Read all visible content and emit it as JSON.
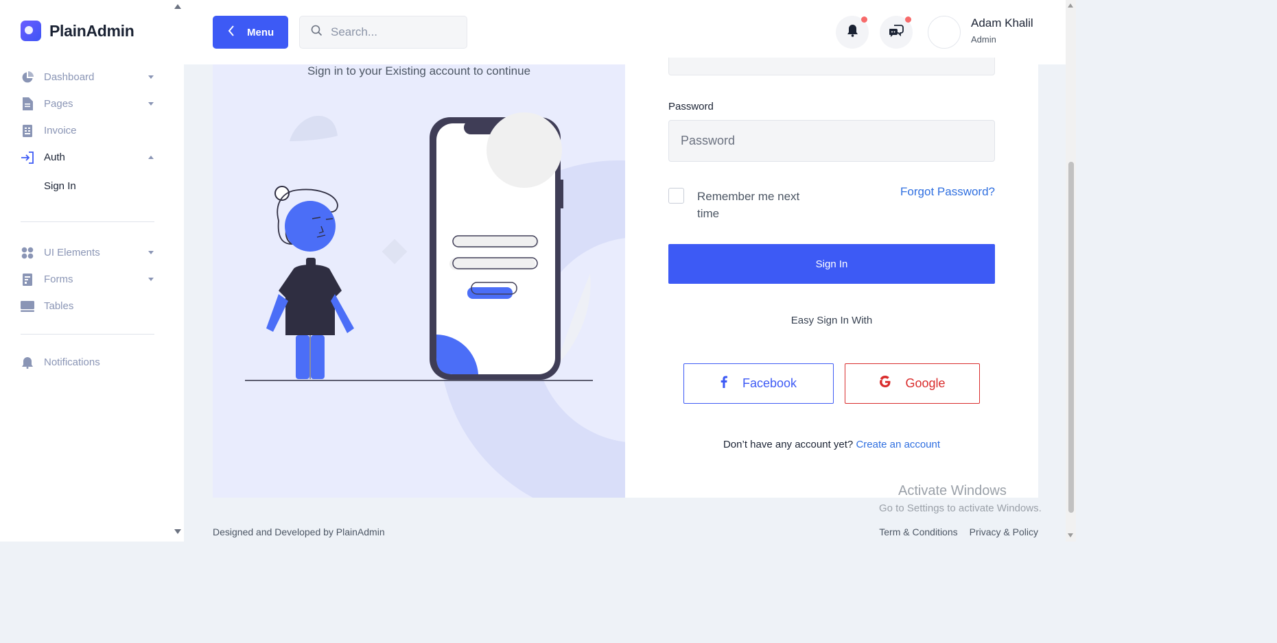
{
  "brand": {
    "name": "PlainAdmin"
  },
  "sidebar": {
    "items": [
      {
        "label": "Dashboard",
        "icon": "pie-chart-icon",
        "has_caret": true
      },
      {
        "label": "Pages",
        "icon": "document-icon",
        "has_caret": true
      },
      {
        "label": "Invoice",
        "icon": "receipt-icon",
        "has_caret": false
      },
      {
        "label": "Auth",
        "icon": "sign-in-icon",
        "has_caret": true,
        "expanded": true,
        "active": true
      }
    ],
    "sub_items": [
      {
        "label": "Sign In"
      }
    ],
    "items2": [
      {
        "label": "UI Elements",
        "icon": "grid-icon",
        "has_caret": true
      },
      {
        "label": "Forms",
        "icon": "form-icon",
        "has_caret": true
      },
      {
        "label": "Tables",
        "icon": "table-icon",
        "has_caret": false
      }
    ],
    "items3": [
      {
        "label": "Notifications",
        "icon": "bell-icon",
        "has_caret": false
      }
    ]
  },
  "header": {
    "menu_label": "Menu",
    "search_placeholder": "Search...",
    "user_name": "Adam Khalil",
    "user_role": "Admin"
  },
  "signin": {
    "tagline": "Sign in to your Existing account to continue",
    "password_label": "Password",
    "password_placeholder": "Password",
    "remember_label": "Remember me next time",
    "forgot_label": "Forgot Password?",
    "signin_label": "Sign In",
    "easy_label": "Easy Sign In With",
    "facebook_label": "Facebook",
    "google_label": "Google",
    "no_account_text": "Don’t have any account yet?",
    "create_account_label": "Create an account"
  },
  "watermark": {
    "title": "Activate Windows",
    "subtitle": "Go to Settings to activate Windows."
  },
  "footer": {
    "credit": "Designed and Developed by PlainAdmin",
    "terms": "Term & Conditions",
    "privacy": "Privacy & Policy"
  },
  "colors": {
    "primary": "#3d5af5",
    "google": "#d92b2b",
    "link": "#2f6fe0",
    "illustration_bg": "#e9ecfd"
  }
}
